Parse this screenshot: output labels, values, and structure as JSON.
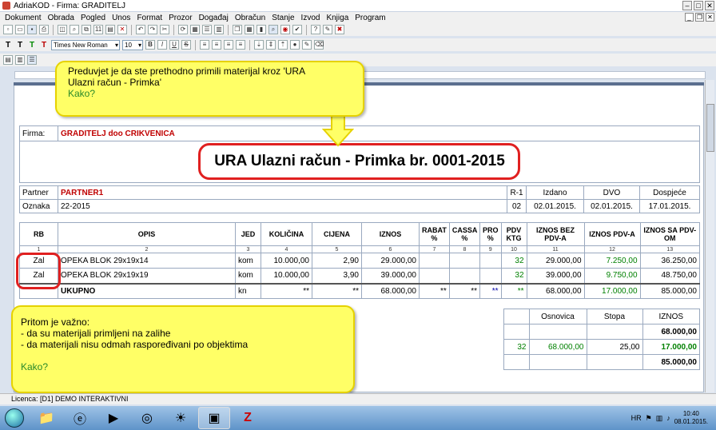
{
  "window": {
    "title": "AdriaKOD - Firma: GRADITELJ"
  },
  "menu": [
    "Dokument",
    "Obrada",
    "Pogled",
    "Unos",
    "Format",
    "Prozor",
    "Događaj",
    "Obračun",
    "Stanje",
    "Izvod",
    "Knjiga",
    "Program"
  ],
  "toolbar": {
    "font": "Times New Roman",
    "size": "10",
    "fmt": [
      "T",
      "T",
      "T",
      "T"
    ]
  },
  "document": {
    "firma_label": "Firma:",
    "firma": "GRADITELJ doo CRIKVENICA",
    "title": "URA Ulazni račun - Primka br. 0001-2015",
    "partner_label": "Partner",
    "partner": "PARTNER1",
    "r1": "R-1",
    "izdano_label": "Izdano",
    "dvo_label": "DVO",
    "dospijece_label": "Dospjeće",
    "oznaka_label": "Oznaka",
    "oznaka": "22-2015",
    "r1_val": "02",
    "izdano": "02.01.2015.",
    "dvo": "02.01.2015.",
    "dospijece": "17.01.2015."
  },
  "items": {
    "headers": [
      "RB",
      "OPIS",
      "JED",
      "KOLIČINA",
      "CIJENA",
      "IZNOS",
      "RABAT %",
      "CASSA %",
      "PRO %",
      "PDV KTG",
      "IZNOS BEZ PDV-A",
      "IZNOS PDV-A",
      "IZNOS SA PDV-OM"
    ],
    "nums": [
      "1",
      "2",
      "3",
      "4",
      "5",
      "6",
      "7",
      "8",
      "9",
      "10",
      "11",
      "12",
      "13"
    ],
    "rows": [
      {
        "rb": "Zal",
        "opis": "OPEKA BLOK 29x19x14",
        "jed": "kom",
        "kol": "10.000,00",
        "cij": "2,90",
        "izn": "29.000,00",
        "ktg": "32",
        "bez": "29.000,00",
        "pdv": "7.250,00",
        "sa": "36.250,00"
      },
      {
        "rb": "Zal",
        "opis": "OPEKA BLOK 29x19x19",
        "jed": "kom",
        "kol": "10.000,00",
        "cij": "3,90",
        "izn": "39.000,00",
        "ktg": "32",
        "bez": "39.000,00",
        "pdv": "9.750,00",
        "sa": "48.750,00"
      }
    ],
    "sum": {
      "label": "UKUPNO",
      "jed": "kn",
      "star": "**",
      "izn": "68.000,00",
      "bez": "68.000,00",
      "pdv": "17.000,00",
      "sa": "85.000,00"
    }
  },
  "recap": {
    "osnovica_label": "Osnovica",
    "stopa_label": "Stopa",
    "iznos_label": "IZNOS",
    "t1": "68.000,00",
    "ktg": "32",
    "osn": "68.000,00",
    "stopa": "25,00",
    "pdv": "17.000,00",
    "total": "85.000,00"
  },
  "callout1": {
    "line1": "Preduvjet je da ste prethodno primili materijal kroz 'URA",
    "line2": "Ulazni račun - Primka'",
    "ask": "Kako?"
  },
  "callout2": {
    "line1": "Pritom je važno:",
    "line2": "- da su materijali primljeni na zalihe",
    "line3": "- da  materijali nisu odmah raspoređivani po objektima",
    "ask": "Kako?"
  },
  "status": {
    "text": "Licenca: [D1] DEMO INTERAKTIVNI"
  },
  "tray": {
    "lang": "HR",
    "time": "10:40",
    "date": "08.01.2015."
  }
}
